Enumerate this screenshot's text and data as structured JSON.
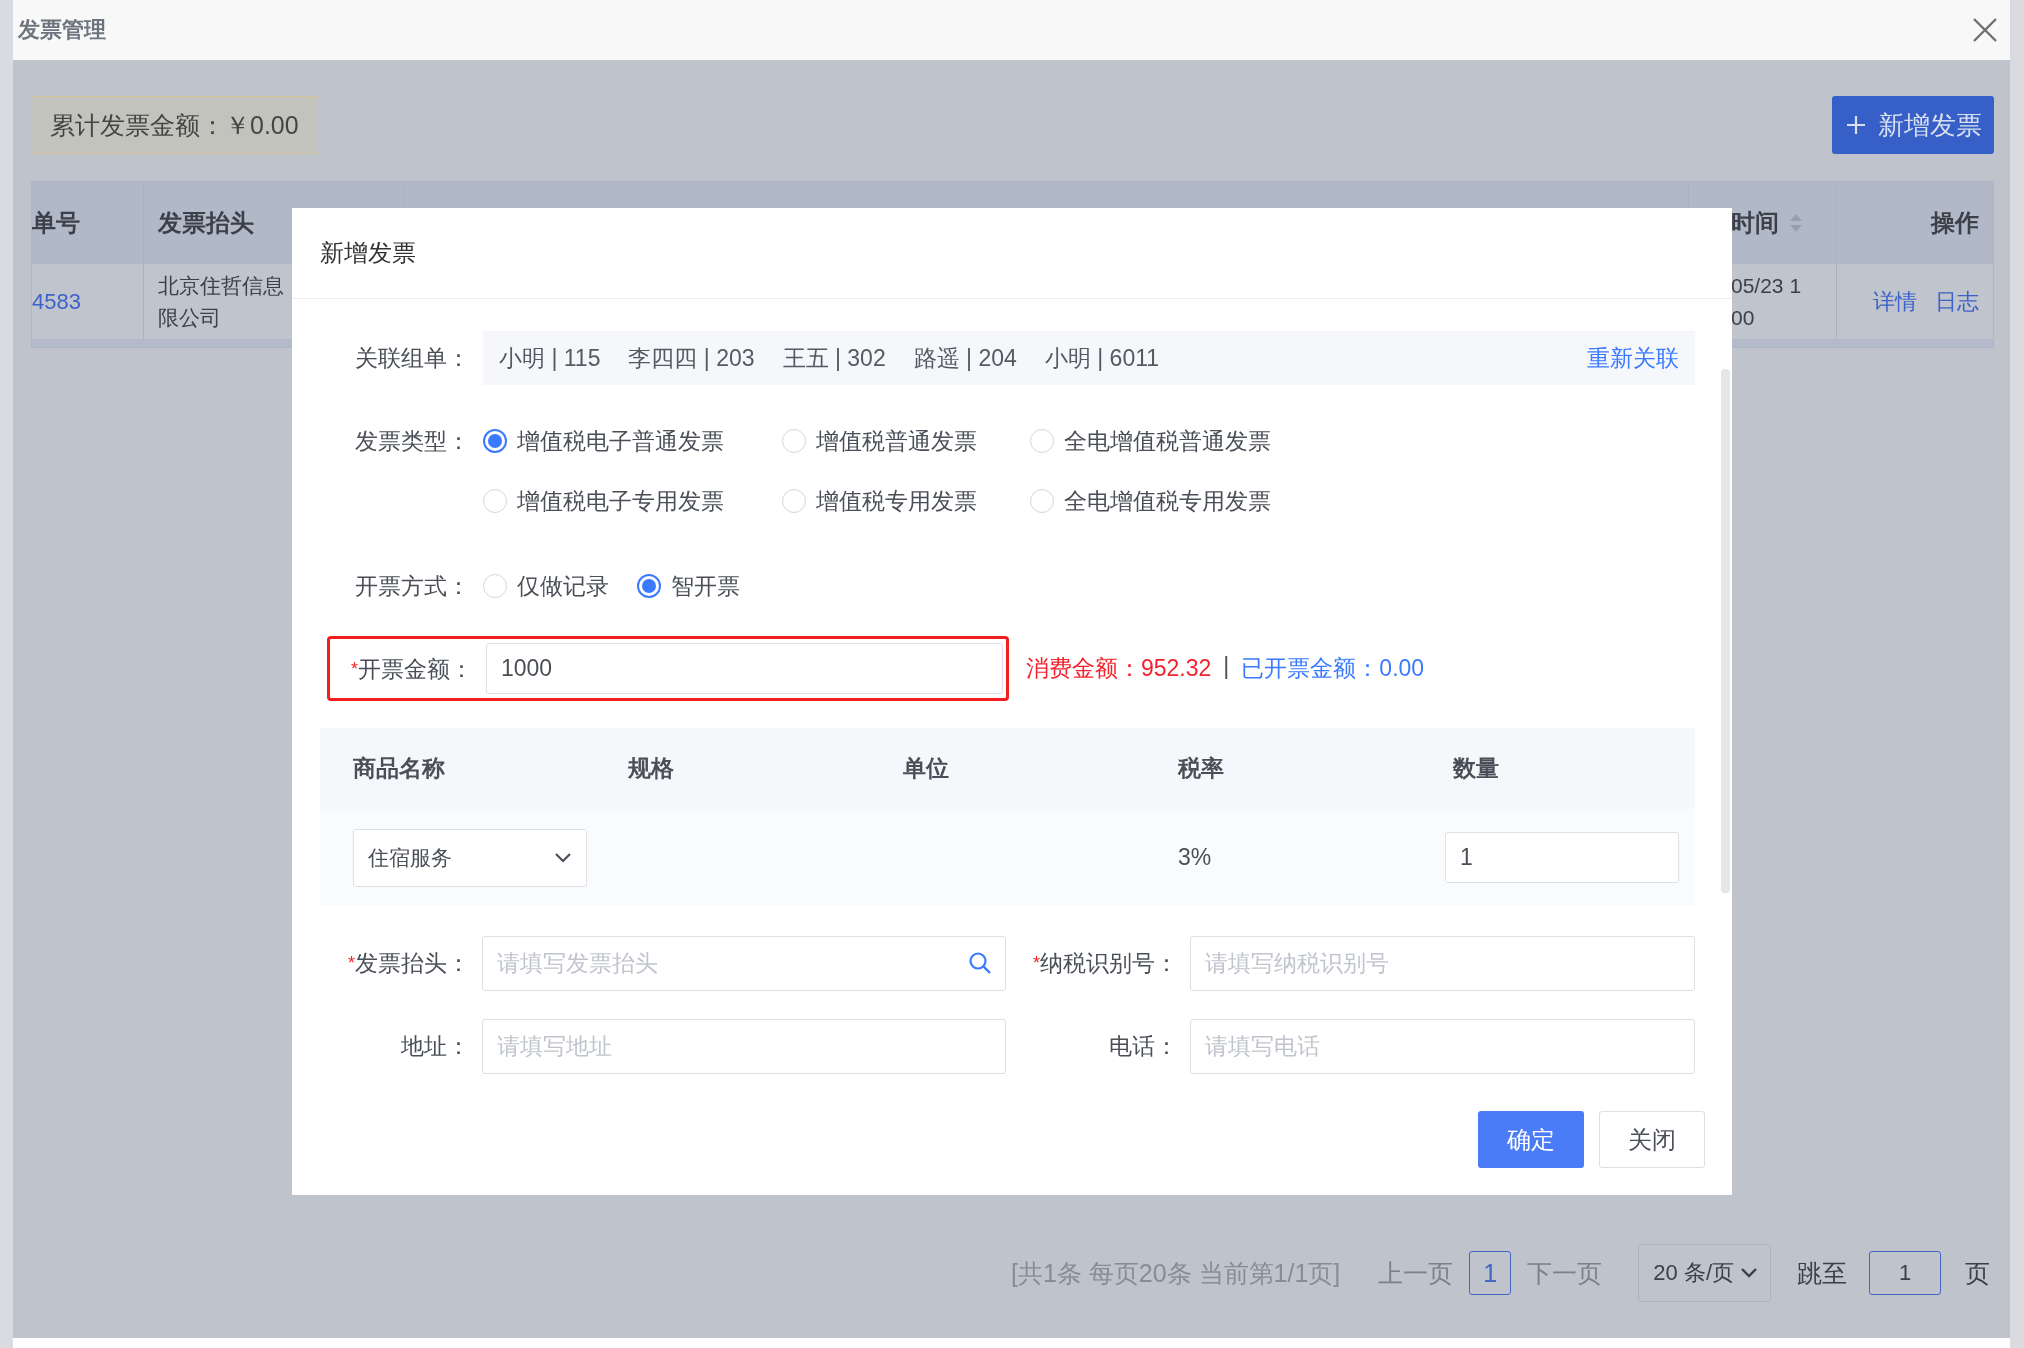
{
  "window": {
    "title": "发票管理"
  },
  "summary": {
    "text": "累计发票金额：￥0.00"
  },
  "add_button": {
    "label": "新增发票"
  },
  "table": {
    "columns": [
      {
        "label": "单号",
        "sortable": false
      },
      {
        "label": "发票抬头",
        "sortable": false
      },
      {
        "label": "时间",
        "sortable": true
      },
      {
        "label": "操作",
        "sortable": false
      }
    ],
    "rows": [
      {
        "order_no": "4583",
        "title_lines": [
          "北京住哲信息",
          "限公司"
        ],
        "time_lines": [
          "05/23 1",
          "00"
        ],
        "actions": [
          "详情",
          "日志"
        ]
      }
    ]
  },
  "pagination": {
    "summary": "[共1条 每页20条 当前第1/1页]",
    "prev": "上一页",
    "pages": [
      {
        "label": "1",
        "selected": true
      }
    ],
    "next": "下一页",
    "page_size": "20 条/页",
    "jump_label": "跳至",
    "jump_value": "1",
    "page_unit": "页"
  },
  "dialog": {
    "title": "新增发票",
    "required_mark": "*",
    "linked_orders": {
      "label": "关联组单：",
      "tags": [
        "小明 | 115",
        "李四四 | 203",
        "王五 | 302",
        "路遥 | 204",
        "小明 | 6011"
      ],
      "action": "重新关联"
    },
    "invoice_type": {
      "label": "发票类型：",
      "options": [
        {
          "label": "增值税电子普通发票",
          "selected": true
        },
        {
          "label": "增值税普通发票",
          "selected": false
        },
        {
          "label": "全电增值税普通发票",
          "selected": false
        },
        {
          "label": "增值税电子专用发票",
          "selected": false
        },
        {
          "label": "增值税专用发票",
          "selected": false
        },
        {
          "label": "全电增值税专用发票",
          "selected": false
        }
      ]
    },
    "issue_method": {
      "label": "开票方式：",
      "options": [
        {
          "label": "仅做记录",
          "selected": false
        },
        {
          "label": "智开票",
          "selected": true
        }
      ]
    },
    "amount": {
      "label": "开票金额：",
      "required": true,
      "highlighted": true,
      "value": "1000",
      "consumed": "消费金额：952.32",
      "separator": "|",
      "issued": "已开票金额：0.00"
    },
    "items": {
      "columns": [
        "商品名称",
        "规格",
        "单位",
        "税率",
        "数量"
      ],
      "rows": [
        {
          "name": "住宿服务",
          "tax_rate": "3%",
          "quantity": "1"
        }
      ]
    },
    "fields": [
      {
        "label": "发票抬头：",
        "required": true,
        "placeholder": "请填写发票抬头",
        "kind": "search"
      },
      {
        "label": "纳税识别号：",
        "required": true,
        "placeholder": "请填写纳税识别号",
        "kind": "text"
      },
      {
        "label": "地址：",
        "required": false,
        "placeholder": "请填写地址",
        "kind": "text"
      },
      {
        "label": "电话：",
        "required": false,
        "placeholder": "请填写电话",
        "kind": "text"
      }
    ],
    "buttons": [
      {
        "label": "确定",
        "kind": "primary"
      },
      {
        "label": "关闭",
        "kind": "default"
      }
    ]
  }
}
